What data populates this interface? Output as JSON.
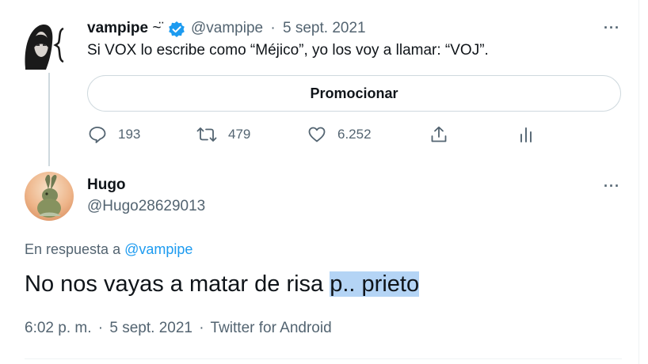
{
  "original_tweet": {
    "name": "vampipe",
    "name_suffix": "~̈",
    "handle": "@vampipe",
    "separator": "·",
    "date": "5 sept. 2021",
    "text": "Si VOX lo escribe como “Méjico”, yo los voy a llamar: “VOJ”.",
    "promote_label": "Promocionar",
    "actions": {
      "replies": "193",
      "retweets": "479",
      "likes": "6.252"
    }
  },
  "reply_tweet": {
    "name": "Hugo",
    "handle": "@Hugo28629013",
    "reply_prefix": "En respuesta a",
    "reply_mention": "@vampipe",
    "text_plain": "No nos vayas a matar de risa ",
    "text_highlighted": "p.. prieto",
    "time": "6:02 p. m.",
    "date": "5 sept. 2021",
    "source": "Twitter for Android",
    "separator": "·"
  },
  "more_label": "···",
  "colors": {
    "verified": "#1d9bf0",
    "link": "#1d9bf0",
    "secondary_text": "#536471",
    "selection_highlight": "#b4d4f5"
  }
}
